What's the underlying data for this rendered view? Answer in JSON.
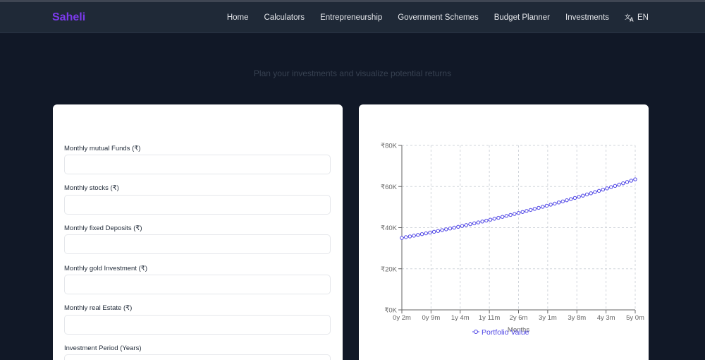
{
  "brand": {
    "name": "Saheli",
    "color": "#7c3aed"
  },
  "nav": {
    "links": [
      "Home",
      "Calculators",
      "Entrepreneurship",
      "Government Schemes",
      "Budget Planner",
      "Investments"
    ],
    "language": {
      "icon": "translate-icon",
      "label": "EN"
    }
  },
  "subtitle": "Plan your investments and visualize potential returns",
  "form": {
    "fields": [
      {
        "label": "Monthly mutual Funds (₹)",
        "value": ""
      },
      {
        "label": "Monthly stocks (₹)",
        "value": ""
      },
      {
        "label": "Monthly fixed Deposits (₹)",
        "value": ""
      },
      {
        "label": "Monthly gold Investment (₹)",
        "value": ""
      },
      {
        "label": "Monthly real Estate (₹)",
        "value": ""
      },
      {
        "label": "Investment Period (Years)",
        "value": ""
      }
    ]
  },
  "chart_data": {
    "type": "line",
    "ylim": [
      0,
      80000
    ],
    "y_ticks": [
      "₹0K",
      "₹20K",
      "₹40K",
      "₹60K",
      "₹80K"
    ],
    "x_ticks": [
      "0y 2m",
      "0y 9m",
      "1y 4m",
      "1y 11m",
      "2y 6m",
      "3y 1m",
      "3y 8m",
      "4y 3m",
      "5y 0m"
    ],
    "xlabel": "Months",
    "grid": true,
    "legend_position": "bottom",
    "series": [
      {
        "name": "Portfolio Value",
        "color": "#4f46e5",
        "marker": "circle",
        "start_value": 35000,
        "end_value": 63500,
        "points": 59
      }
    ]
  }
}
